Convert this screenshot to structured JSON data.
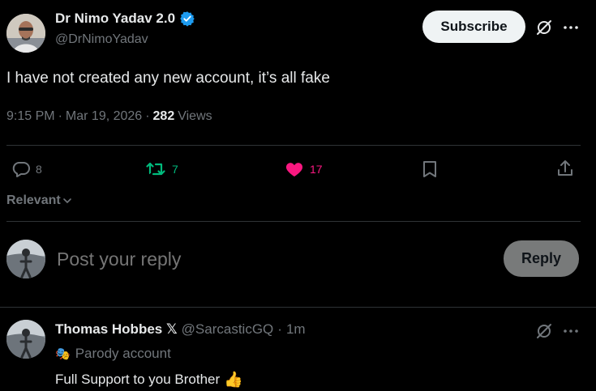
{
  "post": {
    "author_name": "Dr Nimo Yadav 2.0",
    "handle": "@DrNimoYadav",
    "subscribe_label": "Subscribe",
    "text": "I have not created any new account, it’s all fake",
    "time": "9:15 PM",
    "sep1": "·",
    "date": "Mar 19, 2026",
    "sep2": "·",
    "views_count": "282",
    "views_label": "Views",
    "replies": "8",
    "reposts": "7",
    "likes": "17"
  },
  "sort": {
    "label": "Relevant"
  },
  "composer": {
    "placeholder": "Post your reply",
    "reply_label": "Reply"
  },
  "reply": {
    "author_name": "Thomas Hobbes 𝕏",
    "handle": "@SarcasticGQ",
    "sep": "·",
    "time": "1m",
    "badge_icon": "🎭",
    "badge_text": "Parody account",
    "text": "Full Support to you Brother",
    "emoji": "👍"
  },
  "colors": {
    "verified": "#1d9bf0",
    "repost": "#00ba7c",
    "like": "#f91880",
    "muted": "#71767b"
  }
}
